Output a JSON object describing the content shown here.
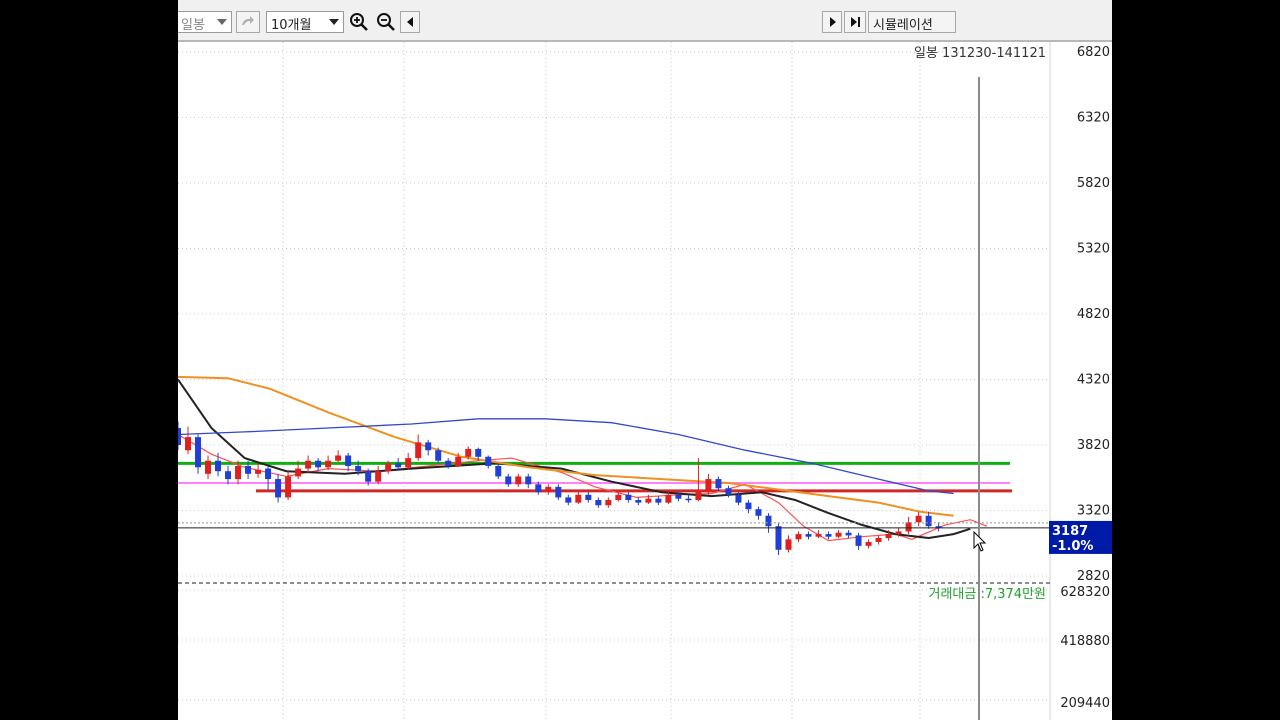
{
  "toolbar": {
    "chart_type_label": "일봉",
    "period_label": "10개월",
    "simulation_label": "시뮬레이션",
    "zoom_in_icon": "zoom-in-icon",
    "zoom_out_icon": "zoom-out-icon",
    "scroll_left_icon": "arrow-left-icon",
    "play_icon": "play-icon",
    "step_end_icon": "step-end-icon"
  },
  "chart_data": {
    "type": "candlestick",
    "title": "일봉  131230-141121",
    "x_range": [
      "131230",
      "141121"
    ],
    "ylim": [
      2820,
      6820
    ],
    "price_ticks": [
      6820,
      6320,
      5820,
      5320,
      4820,
      4320,
      3820,
      3320,
      2820
    ],
    "volume_ticks": [
      628320,
      418880,
      209440
    ],
    "grid": true,
    "current_price": {
      "value": "3187",
      "change": "-1.0%"
    },
    "volume_label": "거래대금 :7,374만원",
    "colors": {
      "up": "#e02020",
      "down": "#1f3fd8",
      "ma5": "#ff5050",
      "ma20": "#222222",
      "ma60": "#f09020",
      "ma120": "#3348c8",
      "support_green": "#10b010",
      "support_red": "#d02828",
      "support_pink": "#ff80ff",
      "price_box": "#001aa8"
    },
    "hlines": [
      {
        "name": "green",
        "value": 3680
      },
      {
        "name": "pink",
        "value": 3530
      },
      {
        "name": "red",
        "value": 3470
      }
    ],
    "series": [
      {
        "name": "ma5",
        "points": [
          [
            0,
            3900
          ],
          [
            0.04,
            3750
          ],
          [
            0.08,
            3650
          ],
          [
            0.13,
            3580
          ],
          [
            0.18,
            3640
          ],
          [
            0.24,
            3620
          ],
          [
            0.3,
            3660
          ],
          [
            0.36,
            3700
          ],
          [
            0.4,
            3720
          ],
          [
            0.46,
            3610
          ],
          [
            0.5,
            3500
          ],
          [
            0.55,
            3420
          ],
          [
            0.6,
            3440
          ],
          [
            0.64,
            3450
          ],
          [
            0.68,
            3520
          ],
          [
            0.72,
            3380
          ],
          [
            0.75,
            3200
          ],
          [
            0.78,
            3090
          ],
          [
            0.82,
            3120
          ],
          [
            0.86,
            3140
          ],
          [
            0.88,
            3100
          ],
          [
            0.92,
            3210
          ],
          [
            0.95,
            3250
          ],
          [
            0.97,
            3200
          ]
        ]
      },
      {
        "name": "ma20",
        "points": [
          [
            0,
            4320
          ],
          [
            0.04,
            3950
          ],
          [
            0.08,
            3720
          ],
          [
            0.13,
            3620
          ],
          [
            0.2,
            3600
          ],
          [
            0.28,
            3640
          ],
          [
            0.38,
            3680
          ],
          [
            0.46,
            3640
          ],
          [
            0.52,
            3540
          ],
          [
            0.58,
            3460
          ],
          [
            0.64,
            3430
          ],
          [
            0.7,
            3460
          ],
          [
            0.74,
            3400
          ],
          [
            0.78,
            3300
          ],
          [
            0.82,
            3210
          ],
          [
            0.86,
            3140
          ],
          [
            0.9,
            3110
          ],
          [
            0.93,
            3140
          ],
          [
            0.95,
            3180
          ]
        ]
      },
      {
        "name": "ma60",
        "points": [
          [
            0,
            4340
          ],
          [
            0.06,
            4330
          ],
          [
            0.11,
            4250
          ],
          [
            0.18,
            4070
          ],
          [
            0.26,
            3880
          ],
          [
            0.34,
            3730
          ],
          [
            0.42,
            3650
          ],
          [
            0.5,
            3590
          ],
          [
            0.58,
            3560
          ],
          [
            0.66,
            3530
          ],
          [
            0.72,
            3480
          ],
          [
            0.78,
            3430
          ],
          [
            0.84,
            3380
          ],
          [
            0.89,
            3310
          ],
          [
            0.93,
            3280
          ]
        ]
      },
      {
        "name": "ma120",
        "points": [
          [
            0,
            3900
          ],
          [
            0.08,
            3920
          ],
          [
            0.18,
            3950
          ],
          [
            0.28,
            3980
          ],
          [
            0.36,
            4020
          ],
          [
            0.44,
            4020
          ],
          [
            0.52,
            3990
          ],
          [
            0.6,
            3900
          ],
          [
            0.68,
            3780
          ],
          [
            0.76,
            3680
          ],
          [
            0.84,
            3560
          ],
          [
            0.9,
            3470
          ],
          [
            0.93,
            3450
          ]
        ]
      }
    ],
    "candles": [
      [
        0.0,
        3950,
        3820,
        4000,
        3780
      ],
      [
        0.012,
        3780,
        3880,
        3960,
        3750
      ],
      [
        0.024,
        3880,
        3650,
        3900,
        3600
      ],
      [
        0.036,
        3600,
        3700,
        3740,
        3560
      ],
      [
        0.048,
        3700,
        3620,
        3760,
        3580
      ],
      [
        0.06,
        3620,
        3560,
        3660,
        3520
      ],
      [
        0.072,
        3560,
        3660,
        3700,
        3520
      ],
      [
        0.084,
        3660,
        3600,
        3700,
        3560
      ],
      [
        0.096,
        3600,
        3630,
        3680,
        3570
      ],
      [
        0.108,
        3640,
        3560,
        3660,
        3480
      ],
      [
        0.12,
        3560,
        3420,
        3600,
        3380
      ],
      [
        0.132,
        3420,
        3580,
        3620,
        3400
      ],
      [
        0.144,
        3580,
        3640,
        3700,
        3560
      ],
      [
        0.156,
        3640,
        3700,
        3740,
        3610
      ],
      [
        0.168,
        3700,
        3650,
        3720,
        3620
      ],
      [
        0.18,
        3650,
        3700,
        3740,
        3630
      ],
      [
        0.192,
        3700,
        3740,
        3780,
        3690
      ],
      [
        0.204,
        3740,
        3660,
        3760,
        3620
      ],
      [
        0.216,
        3660,
        3620,
        3700,
        3590
      ],
      [
        0.228,
        3620,
        3540,
        3640,
        3510
      ],
      [
        0.24,
        3540,
        3620,
        3660,
        3520
      ],
      [
        0.252,
        3620,
        3680,
        3700,
        3600
      ],
      [
        0.264,
        3680,
        3650,
        3720,
        3630
      ],
      [
        0.276,
        3650,
        3720,
        3760,
        3630
      ],
      [
        0.288,
        3720,
        3840,
        3900,
        3700
      ],
      [
        0.3,
        3840,
        3780,
        3860,
        3740
      ],
      [
        0.312,
        3780,
        3700,
        3800,
        3680
      ],
      [
        0.324,
        3700,
        3660,
        3720,
        3640
      ],
      [
        0.336,
        3660,
        3730,
        3760,
        3650
      ],
      [
        0.348,
        3730,
        3790,
        3810,
        3710
      ],
      [
        0.36,
        3790,
        3730,
        3800,
        3700
      ],
      [
        0.372,
        3730,
        3660,
        3740,
        3640
      ],
      [
        0.384,
        3660,
        3580,
        3680,
        3560
      ],
      [
        0.396,
        3580,
        3520,
        3600,
        3500
      ],
      [
        0.408,
        3520,
        3580,
        3600,
        3500
      ],
      [
        0.42,
        3580,
        3520,
        3600,
        3490
      ],
      [
        0.432,
        3520,
        3460,
        3540,
        3440
      ],
      [
        0.444,
        3460,
        3500,
        3520,
        3440
      ],
      [
        0.456,
        3500,
        3420,
        3520,
        3400
      ],
      [
        0.468,
        3420,
        3380,
        3440,
        3360
      ],
      [
        0.48,
        3380,
        3440,
        3460,
        3370
      ],
      [
        0.492,
        3440,
        3400,
        3460,
        3380
      ],
      [
        0.504,
        3400,
        3360,
        3420,
        3340
      ],
      [
        0.516,
        3360,
        3400,
        3420,
        3340
      ],
      [
        0.528,
        3400,
        3440,
        3470,
        3390
      ],
      [
        0.54,
        3440,
        3400,
        3460,
        3380
      ],
      [
        0.552,
        3400,
        3380,
        3420,
        3360
      ],
      [
        0.564,
        3380,
        3410,
        3440,
        3370
      ],
      [
        0.576,
        3410,
        3380,
        3430,
        3360
      ],
      [
        0.588,
        3380,
        3440,
        3460,
        3370
      ],
      [
        0.6,
        3440,
        3410,
        3460,
        3390
      ],
      [
        0.612,
        3410,
        3400,
        3440,
        3380
      ],
      [
        0.624,
        3400,
        3460,
        3720,
        3390
      ],
      [
        0.636,
        3460,
        3560,
        3600,
        3440
      ],
      [
        0.648,
        3560,
        3490,
        3580,
        3470
      ],
      [
        0.66,
        3490,
        3440,
        3510,
        3420
      ],
      [
        0.672,
        3440,
        3380,
        3460,
        3360
      ],
      [
        0.684,
        3380,
        3330,
        3400,
        3300
      ],
      [
        0.696,
        3330,
        3280,
        3350,
        3250
      ],
      [
        0.708,
        3280,
        3200,
        3300,
        3150
      ],
      [
        0.72,
        3200,
        3020,
        3220,
        2980
      ],
      [
        0.732,
        3020,
        3100,
        3130,
        3000
      ],
      [
        0.744,
        3100,
        3140,
        3160,
        3080
      ],
      [
        0.756,
        3140,
        3120,
        3160,
        3100
      ],
      [
        0.768,
        3120,
        3140,
        3170,
        3110
      ],
      [
        0.78,
        3140,
        3120,
        3160,
        3100
      ],
      [
        0.792,
        3120,
        3150,
        3170,
        3110
      ],
      [
        0.804,
        3150,
        3130,
        3170,
        3110
      ],
      [
        0.816,
        3130,
        3050,
        3150,
        3020
      ],
      [
        0.828,
        3050,
        3080,
        3100,
        3030
      ],
      [
        0.84,
        3080,
        3110,
        3130,
        3060
      ],
      [
        0.852,
        3110,
        3140,
        3170,
        3090
      ],
      [
        0.864,
        3140,
        3160,
        3190,
        3120
      ],
      [
        0.876,
        3160,
        3230,
        3270,
        3140
      ],
      [
        0.888,
        3230,
        3280,
        3310,
        3200
      ],
      [
        0.9,
        3280,
        3200,
        3310,
        3180
      ],
      [
        0.912,
        3200,
        3187,
        3230,
        3160
      ]
    ]
  }
}
